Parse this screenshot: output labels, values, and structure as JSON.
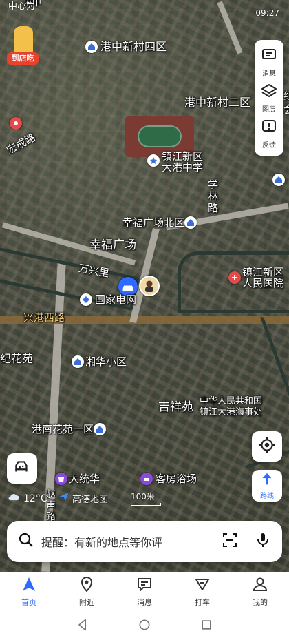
{
  "status_bar": {
    "time": "09:27",
    "left_text": "中心为"
  },
  "promo_badge": "到店吃",
  "tools": [
    {
      "label": "消息",
      "icon": "message-icon"
    },
    {
      "label": "图层",
      "icon": "layers-icon"
    },
    {
      "label": "反馈",
      "icon": "feedback-icon"
    }
  ],
  "map_labels": {
    "gangzhong_4": "港中新村四区",
    "gangzhong_2": "港中新村二区",
    "hongcheng_road": "宏成路",
    "dagang_school_l1": "镇江新区",
    "dagang_school_l2": "大港中学",
    "xuelin_road": "学林路",
    "xingfu_north": "幸福广场北区",
    "xingfu_square": "幸福广场",
    "wanxing_li": "万兴里",
    "hospital_l1": "镇江新区",
    "hospital_l2": "人民医院",
    "state_grid": "国家电网",
    "xinggang_west_road": "兴港西路",
    "jihua_yuan": "纪花苑",
    "xianghua": "湘华小区",
    "jixiang_yuan": "吉祥苑",
    "maritime_l1": "中华人民共和国",
    "maritime_l2": "镇江大港海事处",
    "gangnan_1": "港南花苑一区",
    "datonghua": "大统华",
    "kefang_bath": "客房浴场",
    "zhao_road": "赵声路",
    "edge_top": "港中",
    "edge_right1": "红",
    "edge_right2": "会"
  },
  "weather": {
    "temp": "12°C"
  },
  "logo_text": "高德地图",
  "scale": "100米",
  "route_button": "路线",
  "search": {
    "placeholder": "提醒：有新的地点等你评"
  },
  "nav": [
    {
      "label": "首页",
      "icon": "home-icon",
      "active": true
    },
    {
      "label": "附近",
      "icon": "location-pin-icon"
    },
    {
      "label": "消息",
      "icon": "chat-icon"
    },
    {
      "label": "打车",
      "icon": "taxi-icon"
    },
    {
      "label": "我的",
      "icon": "user-icon"
    }
  ]
}
